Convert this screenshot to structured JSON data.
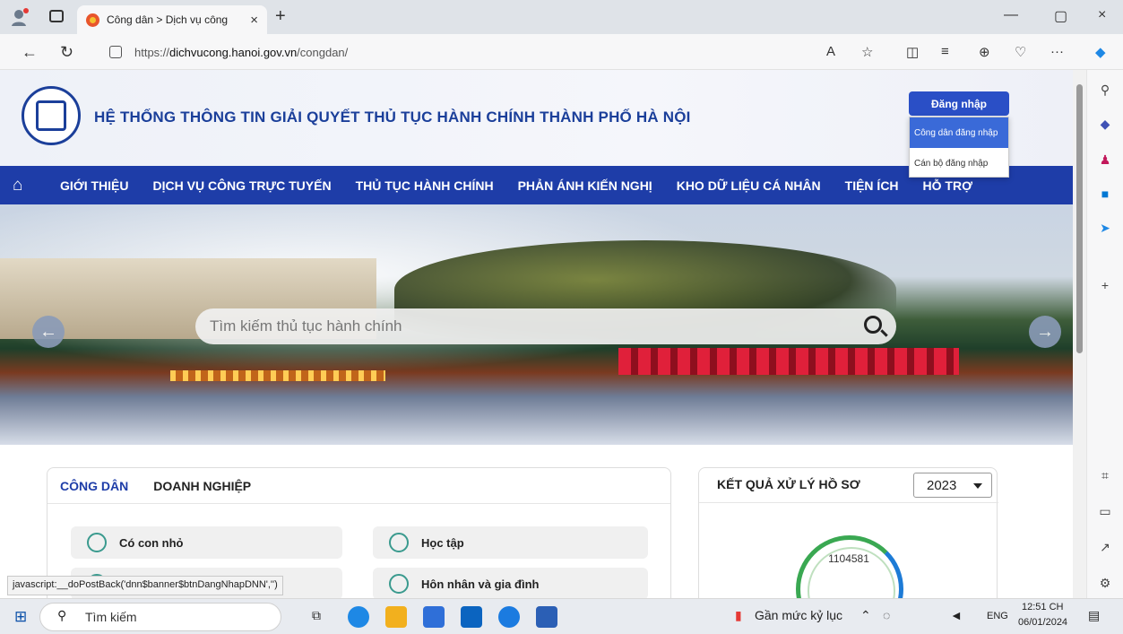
{
  "browser": {
    "tab_title": "Công dân > Dịch vụ công",
    "tab_close": "×",
    "new_tab": "+",
    "url_prefix": "https://",
    "url_host": "dichvucong.hanoi.gov.vn",
    "url_path": "/congdan/",
    "window_minimize": "—",
    "window_restore": "▢",
    "window_close": "×"
  },
  "site": {
    "title": "HỆ THỐNG THÔNG TIN GIẢI QUYẾT THỦ TỤC HÀNH CHÍNH THÀNH PHỐ HÀ NỘI",
    "login_button": "Đăng nhập",
    "login_menu": [
      "Công dân đăng nhập",
      "Cán bộ đăng nhập"
    ],
    "nav": [
      "GIỚI THIỆU",
      "DỊCH VỤ CÔNG TRỰC TUYẾN",
      "THỦ TỤC HÀNH CHÍNH",
      "PHẢN ÁNH KIẾN NGHỊ",
      "KHO DỮ LIỆU CÁ NHÂN",
      "TIỆN ÍCH",
      "HỖ TRỢ"
    ],
    "search_placeholder": "Tìm kiếm thủ tục hành chính"
  },
  "services": {
    "tabs": [
      "CÔNG DÂN",
      "DOANH NGHIỆP"
    ],
    "categories": [
      "Có con nhỏ",
      "Học tập",
      "Hôn nhân và gia đình"
    ]
  },
  "results": {
    "title": "KẾT QUẢ XỬ LÝ HỒ SƠ",
    "year": "2023",
    "total": "1104581",
    "total_fraction": 0.85
  },
  "status_url": "javascript:__doPostBack('dnn$banner$btnDangNhapDNN','')",
  "taskbar": {
    "search": "Tìm kiếm",
    "weather": "Gần mức kỷ lục",
    "lang": "ENG",
    "time": "12:51 CH",
    "date": "06/01/2024"
  }
}
